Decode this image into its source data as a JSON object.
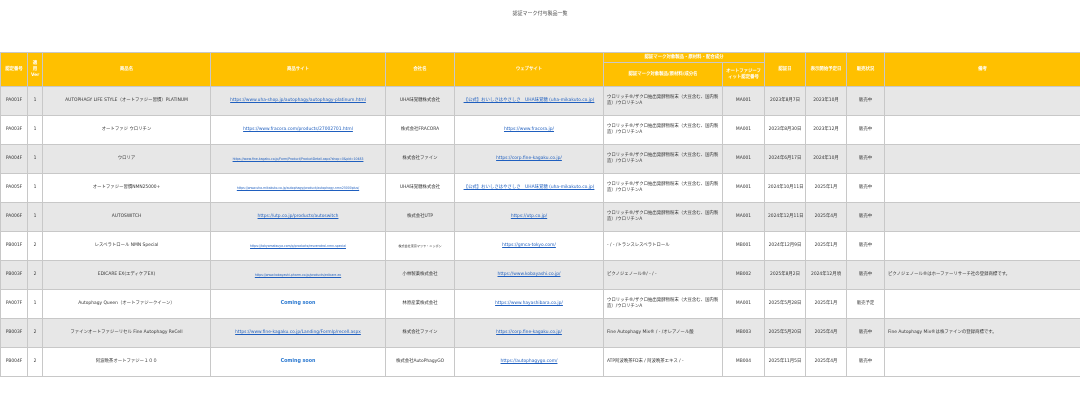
{
  "page": {
    "title": "認証マーク付与製品一覧"
  },
  "headers": {
    "group": "認証マーク対象製品・原材料・配合成分",
    "cols": [
      "認定番号",
      "適用Ver",
      "商品名",
      "商品サイト",
      "会社名",
      "ウェブサイト",
      "認証マーク対象製品/原材料/成分名",
      "オートファジーフィット認定番号",
      "認証日",
      "表示開始予定日",
      "販売状況",
      "備考"
    ]
  },
  "rows": [
    [
      "PA001F",
      "1",
      "AUTOPHAGY LIFE STYLE（オートファジー習慣）PLATINUM",
      "https://www.uha-shop.jp/autophagy/autophagy-platinum.html",
      "UHA味覚糖株式会社",
      "【公式】おいしさはやさしさ　UHA味覚糖 (uha-mikakuto.co.jp)",
      "ウロリッチ®/ザクロ抽出発酵物粉末（大豆含む、国内製造）/ウロリチンA",
      "MA001",
      "2023年8月7日",
      "2023年10月",
      "販売中",
      ""
    ],
    [
      "PA003F",
      "1",
      "オートファジ ウロリチン",
      "https://www.fracora.com/products/27002701.html",
      "株式会社FRACORA",
      "https://www.fracora.jp/",
      "ウロリッチ®/ザクロ抽出発酵物粉末（大豆含む、国内製造）/ウロリチンA",
      "MA001",
      "2023年8月30日",
      "2023年12月",
      "販売中",
      ""
    ],
    [
      "PA004F",
      "1",
      "ウロリア",
      "https://www.fine-kagaku.co.jp/Form/Product/ProductDetail.aspx?shop=0&pid=10483",
      "株式会社ファイン",
      "https://corp.fine-kagaku.co.jp/",
      "ウロリッチ®/ザクロ抽出発酵物粉末（大豆含む、国内製造）/ウロリチンA",
      "MA001",
      "2024年6月17日",
      "2024年10月",
      "販売中",
      ""
    ],
    [
      "PA005F",
      "1",
      "オートファジー習慣NMN25000+",
      "https://www.uha-mikakuto.co.jp/autophagy/product/autophagy-nmn25000plus/",
      "UHA味覚糖株式会社",
      "【公式】おいしさはやさしさ　UHA味覚糖 (uha-mikakuto.co.jp)",
      "ウロリッチ®/ザクロ抽出発酵物粉末（大豆含む、国内製造）/ウロリチンA",
      "MA001",
      "2024年10月11日",
      "2025年1月",
      "販売中",
      ""
    ],
    [
      "PA006F",
      "1",
      "AUTOSWITCH",
      "https://utp.co.jp/products/autoswitch",
      "株式会社UTP",
      "https://utp.co.jp/",
      "ウロリッチ®/ザクロ抽出発酵物粉末（大豆含む、国内製造）/ウロリチンA",
      "MA001",
      "2024年12月11日",
      "2025年4月",
      "販売中",
      ""
    ],
    [
      "PB001F",
      "2",
      "レスベラトロール NMN Special",
      "https://tokyomatsuya.com/p/products/resveratrol-nmn-special",
      "株式会社東京マツヤ・ニッポン",
      "https://gmca-tokyo.com/",
      "- / - /トランスレスベラトロール",
      "MB001",
      "2024年12月9日",
      "2025年1月",
      "販売中",
      ""
    ],
    [
      "PB003F",
      "2",
      "EDICARE EX(エディケアEX)",
      "https://www.kobayashi-pharm.co.jp/products/edicare-ex",
      "小林製薬株式会社",
      "https://www.kobayashi.co.jp/",
      "ピクノジェノール®/ - / -",
      "MB002",
      "2025年8月2日",
      "2024年12月頃",
      "販売中",
      "ピクノジェノール®はホーファーリサーチ社の登録商標です。"
    ],
    [
      "PA007F",
      "1",
      "Autophagy Queen（オートファジークイーン）",
      "Coming soon",
      "林原産業株式会社",
      "https://www.hayashibara.co.jp/",
      "ウロリッチ®/ザクロ抽出発酵物粉末（大豆含む、国内製造）/ウロリチンA",
      "MA001",
      "2025年5月28日",
      "2025年1月",
      "販売予定",
      ""
    ],
    [
      "PB003F",
      "2",
      "ファインオートファジーリセル Fine Autophagy ReCell",
      "https://www.fine-kagaku.co.jp/Landing/Formlp/recell.aspx",
      "株式会社ファイン",
      "https://corp.fine-kagaku.co.jp/",
      "Fine Autophagy Mix®  /  - /オレアノール酸",
      "MB003",
      "2025年5月20日",
      "2025年4月",
      "販売中",
      "Fine Autophagy Mix®は株ファインの登録商標です。"
    ],
    [
      "PB004F",
      "2",
      "阿波晩茶オートファジー１００",
      "Coming soon",
      "株式会社AutoPhagyGO",
      "https://autophagygo.com/",
      "ATP阿波晩茶FD末 / 阿波晩茶エキス / -",
      "MB004",
      "2025年11月5日",
      "2025年4月",
      "販売中",
      ""
    ]
  ]
}
